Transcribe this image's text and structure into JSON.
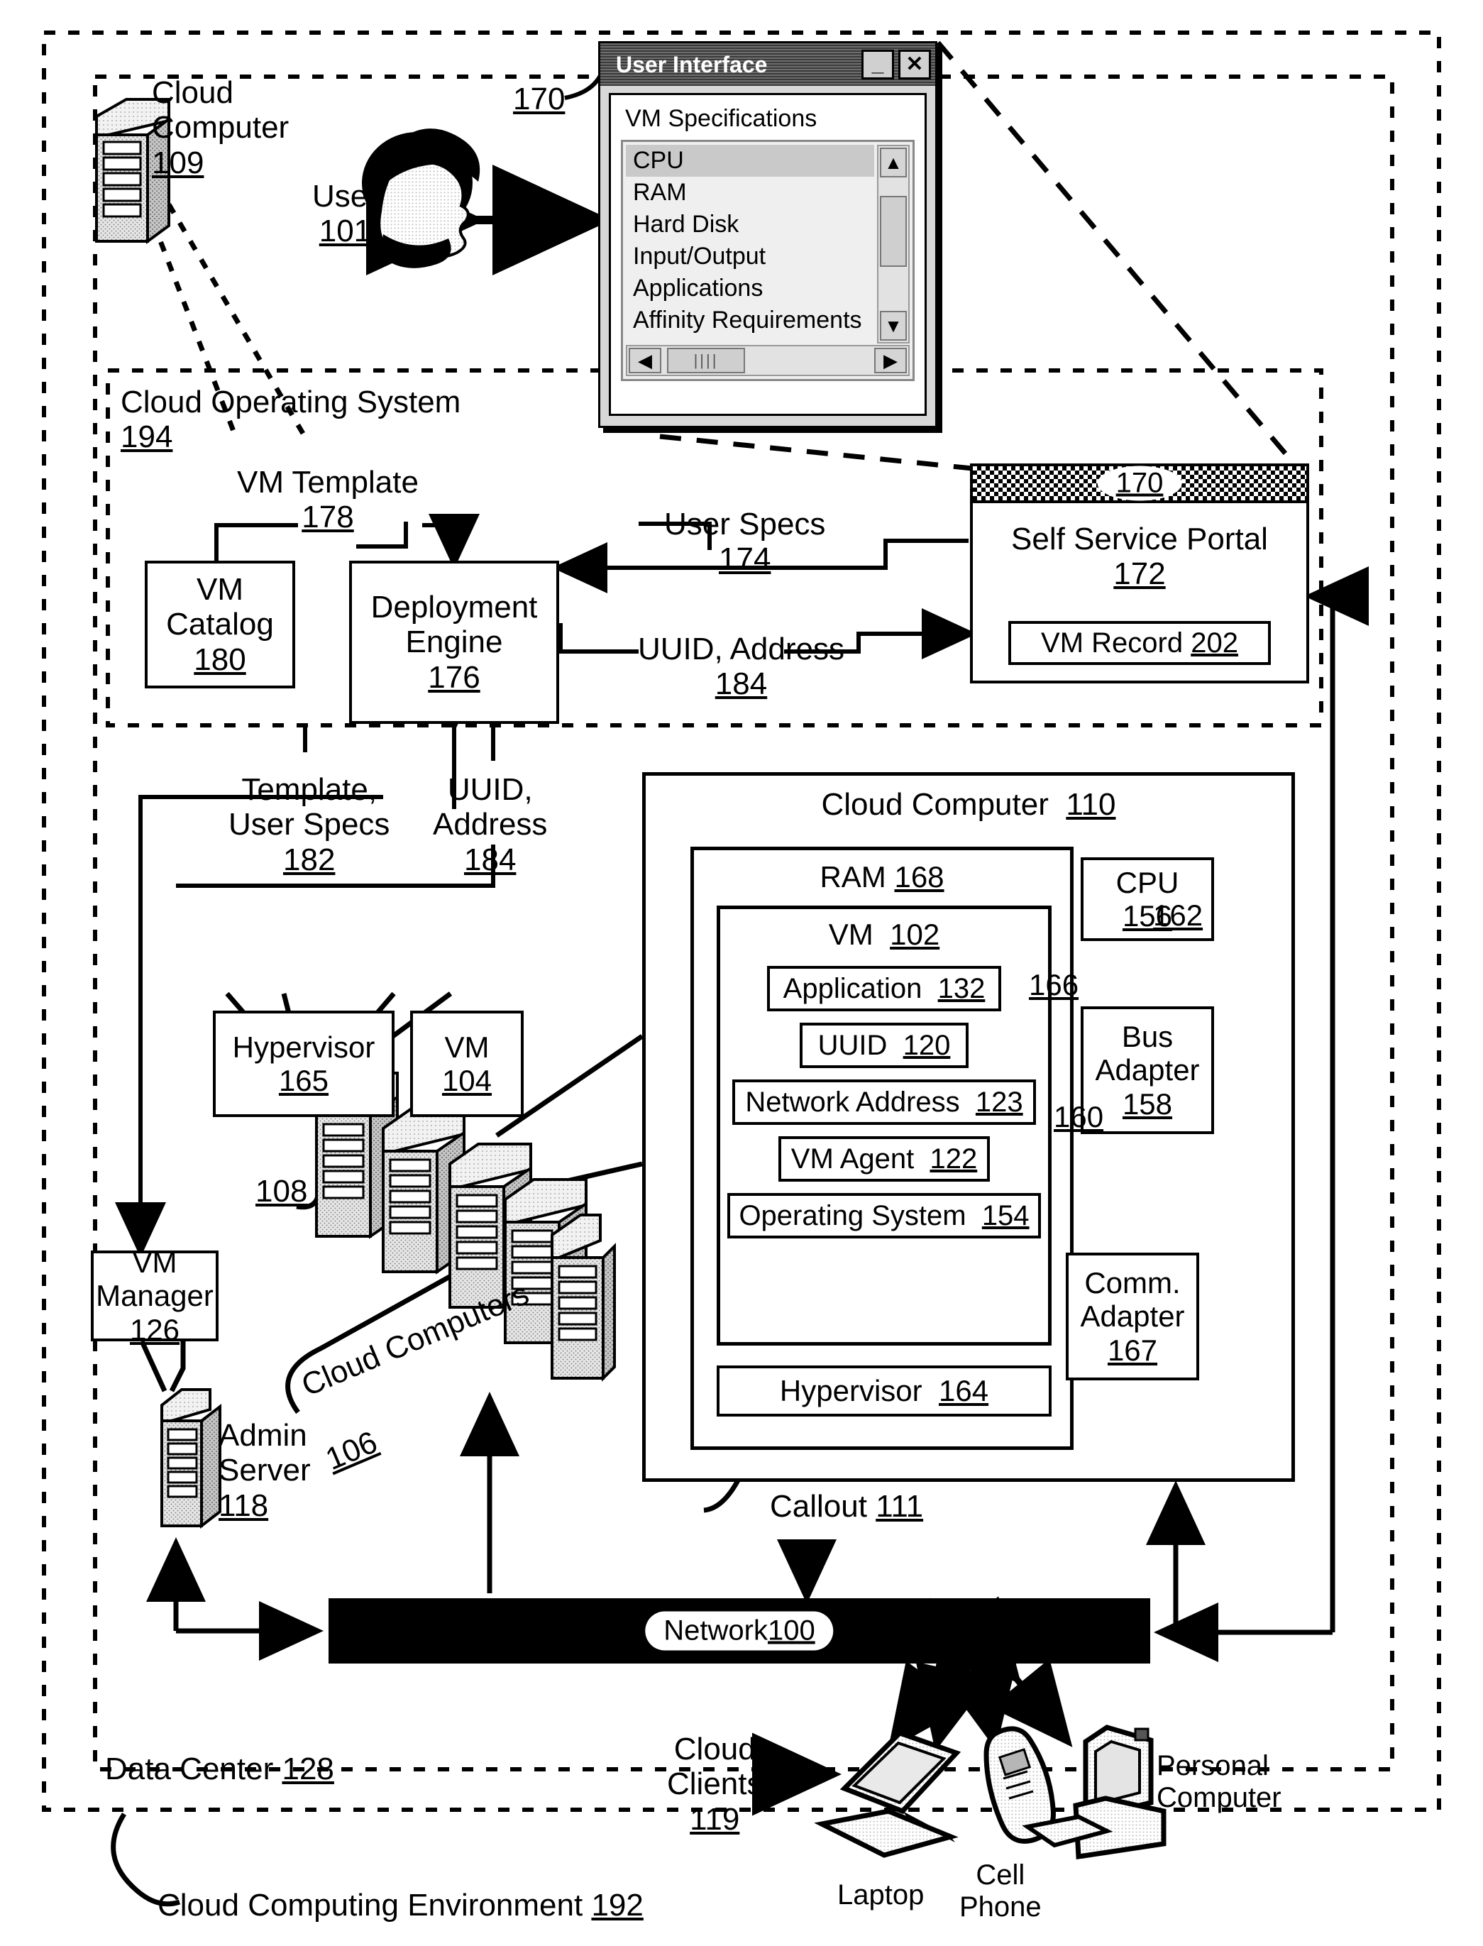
{
  "figure": {
    "outer_label": "Cloud Computing Environment 192",
    "data_center_label": "Data Center 128",
    "cloud_os_label": "Cloud Operating System",
    "cloud_os_ref": "194"
  },
  "dialog": {
    "title": "User Interface",
    "ref": "170",
    "minimize_label": "_",
    "close_label": "✕",
    "section_label": "VM Specifications",
    "items": [
      "CPU",
      "RAM",
      "Hard Disk",
      "Input/Output",
      "Applications",
      "Affinity Requirements"
    ],
    "selected_item": "CPU",
    "scroll_up": "▲",
    "scroll_down": "▼",
    "scroll_left": "◀",
    "scroll_right": "▶",
    "hthumb_grip": "||||"
  },
  "top": {
    "cloud_computer_name": "Cloud",
    "cloud_computer_name2": "Computer",
    "cloud_computer_ref": "109",
    "user_label": "User",
    "user_ref": "101"
  },
  "portal": {
    "badge_ref": "170",
    "title": "Self Service Portal",
    "ref": "172",
    "vm_record": "VM Record",
    "vm_record_ref": "202"
  },
  "cloud_os": {
    "vm_template_label": "VM Template",
    "vm_template_ref": "178",
    "vm_catalog_l1": "VM",
    "vm_catalog_l2": "Catalog",
    "vm_catalog_ref": "180",
    "deployment_l1": "Deployment",
    "deployment_l2": "Engine",
    "deployment_ref": "176",
    "user_specs_label": "User Specs",
    "user_specs_ref": "174",
    "uuid_addr_label": "UUID, Address",
    "uuid_addr_ref": "184"
  },
  "flows": {
    "template_l1": "Template,",
    "template_l2": "User Specs",
    "template_ref": "182",
    "uuid_l1": "UUID,",
    "uuid_l2": "Address",
    "uuid_ref": "184"
  },
  "left": {
    "hypervisor_label": "Hypervisor",
    "hypervisor_ref": "165",
    "vm_label": "VM",
    "vm_ref": "104",
    "stack_ref": "108",
    "cloud_computers_label": "Cloud Computers",
    "cloud_computers_ref": "106",
    "vm_manager_l1": "VM",
    "vm_manager_l2": "Manager",
    "vm_manager_ref": "126",
    "admin_server_l1": "Admin",
    "admin_server_l2": "Server",
    "admin_server_ref": "118"
  },
  "cloud_computer": {
    "title": "Cloud Computer",
    "ref": "110",
    "ram_label": "RAM",
    "ram_ref": "168",
    "vm_label": "VM",
    "vm_ref": "102",
    "rows": [
      {
        "label": "Application",
        "ref": "132"
      },
      {
        "label": "UUID",
        "ref": "120"
      },
      {
        "label": "Network Address",
        "ref": "123"
      },
      {
        "label": "VM Agent",
        "ref": "122"
      },
      {
        "label": "Operating System",
        "ref": "154"
      }
    ],
    "hypervisor_label": "Hypervisor",
    "hypervisor_ref": "164",
    "cpu_label": "CPU",
    "cpu_ref": "156",
    "bus_l1": "Bus",
    "bus_l2": "Adapter",
    "bus_ref": "158",
    "comm_l1": "Comm.",
    "comm_l2": "Adapter",
    "comm_ref": "167",
    "bus162": "162",
    "bus160": "160",
    "bus166": "166",
    "callout_label": "Callout 111"
  },
  "network": {
    "label": "Network",
    "ref": "100"
  },
  "clients": {
    "cloud_l1": "Cloud",
    "cloud_l2": "Clients",
    "ref": "119",
    "laptop": "Laptop",
    "cell_l1": "Cell",
    "cell_l2": "Phone",
    "pc_l1": "Personal",
    "pc_l2": "Computer"
  }
}
